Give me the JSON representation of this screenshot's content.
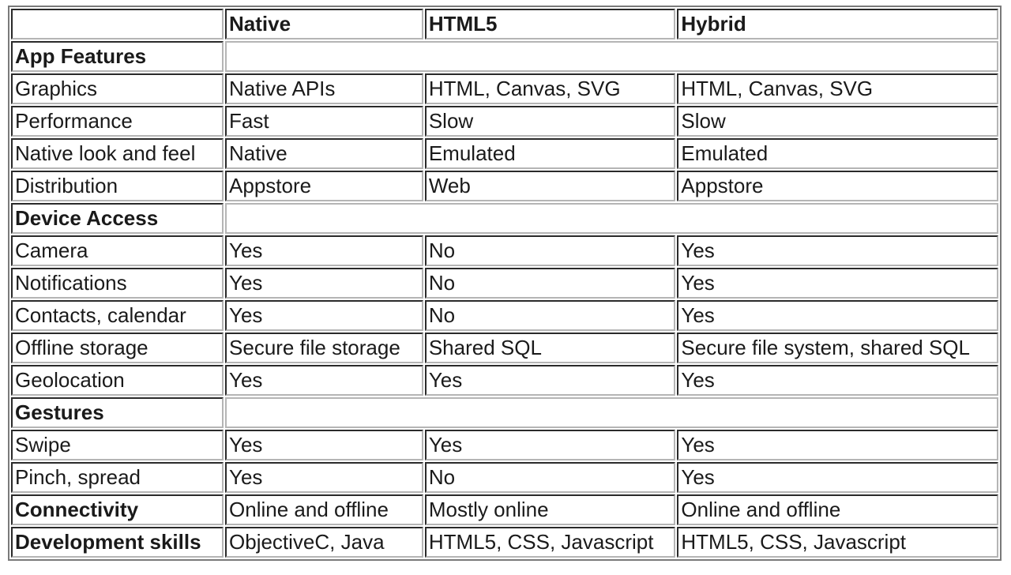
{
  "table": {
    "headers": [
      "",
      "Native",
      "HTML5",
      "Hybrid"
    ],
    "sections": [
      {
        "title": "App Features",
        "rows": [
          [
            "Graphics",
            "Native APIs",
            "HTML, Canvas, SVG",
            "HTML, Canvas, SVG"
          ],
          [
            "Performance",
            "Fast",
            "Slow",
            "Slow"
          ],
          [
            "Native look and feel",
            "Native",
            "Emulated",
            "Emulated"
          ],
          [
            "Distribution",
            "Appstore",
            "Web",
            "Appstore"
          ]
        ]
      },
      {
        "title": "Device Access",
        "rows": [
          [
            "Camera",
            "Yes",
            "No",
            "Yes"
          ],
          [
            "Notifications",
            "Yes",
            "No",
            "Yes"
          ],
          [
            "Contacts, calendar",
            "Yes",
            "No",
            "Yes"
          ],
          [
            "Offline storage",
            "Secure file storage",
            "Shared SQL",
            "Secure file system, shared SQL"
          ],
          [
            "Geolocation",
            "Yes",
            "Yes",
            "Yes"
          ]
        ]
      },
      {
        "title": "Gestures",
        "rows": [
          [
            "Swipe",
            "Yes",
            "Yes",
            "Yes"
          ],
          [
            "Pinch, spread",
            "Yes",
            "No",
            "Yes"
          ]
        ]
      }
    ],
    "summary_rows": [
      [
        "Connectivity",
        "Online and offline",
        "Mostly online",
        "Online and offline"
      ],
      [
        "Development skills",
        "ObjectiveC, Java",
        "HTML5, CSS, Javascript",
        "HTML5, CSS, Javascript"
      ]
    ]
  }
}
